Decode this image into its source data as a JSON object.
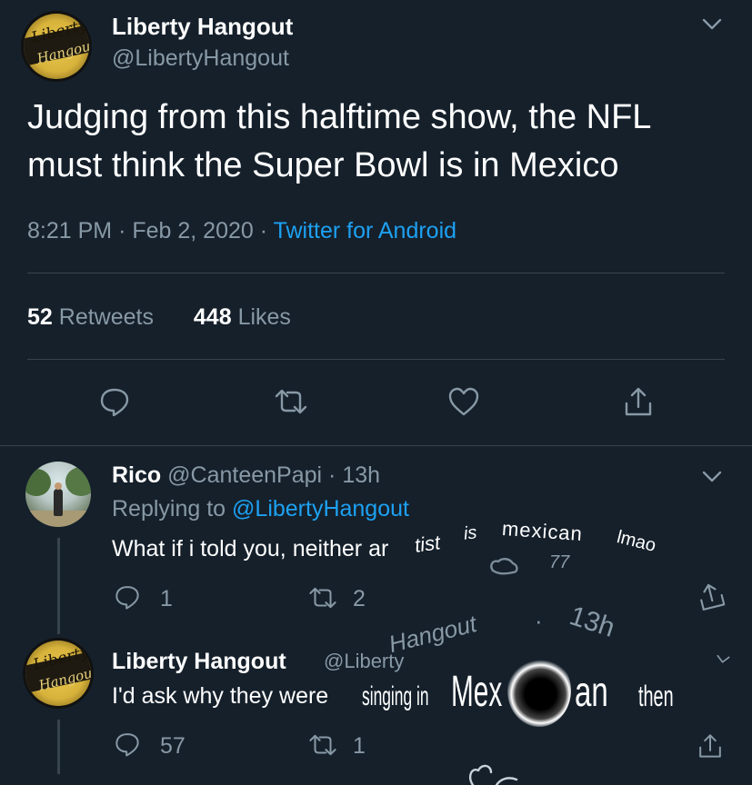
{
  "main_tweet": {
    "display_name": "Liberty Hangout",
    "handle": "@LibertyHangout",
    "text_line1": "Judging from this halftime show, the NFL",
    "text_line2": "must think the Super Bowl is in Mexico",
    "time": "8:21 PM",
    "date": "Feb 2, 2020",
    "source": "Twitter for Android",
    "retweets_count": "52",
    "retweets_label": "Retweets",
    "likes_count": "448",
    "likes_label": "Likes",
    "separator": "·"
  },
  "avatar_logo": {
    "line1": "Liberty",
    "line2": "Hangout"
  },
  "reply1": {
    "display_name": "Rico",
    "handle": "@CanteenPapi",
    "separator": "·",
    "age": "13h",
    "replying_prefix": "Replying to",
    "replying_to": "@LibertyHangout",
    "text_plain": "What if i told you, neither ar",
    "text_warp_a": "tist",
    "text_warp_b": "is",
    "text_warp_c": "mexican",
    "text_warp_d": "lmao",
    "ghost_count": "77",
    "reply_count": "1",
    "retweet_count": "2"
  },
  "reply2": {
    "display_name": "Liberty Hangout",
    "handle_a": "@Liberty",
    "handle_b": "Hangout",
    "separator": "·",
    "age": "13h",
    "text_plain": "I'd ask why they were",
    "text_warp_a": "singing in",
    "text_warp_b": "Mex",
    "text_warp_c": "an",
    "text_warp_d": "then",
    "reply_count": "57",
    "retweet_count": "1"
  },
  "colors": {
    "background": "#15202b",
    "accent": "#1da1f2",
    "muted": "#8899a6",
    "divider": "#38444d"
  },
  "icons": [
    "chevron-down-icon",
    "reply-icon",
    "retweet-icon",
    "like-icon",
    "share-icon"
  ]
}
